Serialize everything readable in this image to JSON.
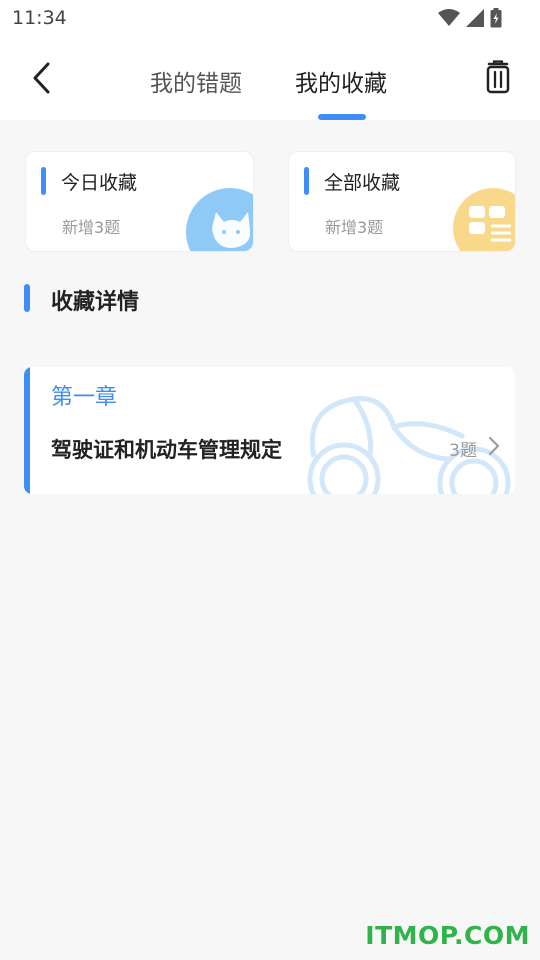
{
  "status_bar": {
    "time": "11:34"
  },
  "nav": {
    "tabs": [
      {
        "label": "我的错题",
        "active": false
      },
      {
        "label": "我的收藏",
        "active": true
      }
    ]
  },
  "cards": [
    {
      "title": "今日收藏",
      "subtitle": "新增3题"
    },
    {
      "title": "全部收藏",
      "subtitle": "新增3题"
    }
  ],
  "section": {
    "title": "收藏详情"
  },
  "chapters": [
    {
      "label": "第一章",
      "name": "驾驶证和机动车管理规定",
      "count": "3题"
    }
  ],
  "watermark": "ITMOP.COM",
  "colors": {
    "accent": "#3f8ef7",
    "watermark": "#2fb34a",
    "card_icon_blue": "#8fcaf7",
    "card_icon_yellow": "#f8d88a"
  },
  "icons": [
    "wifi-icon",
    "signal-icon",
    "battery-icon",
    "back-arrow-icon",
    "trash-icon",
    "chevron-right-icon"
  ]
}
